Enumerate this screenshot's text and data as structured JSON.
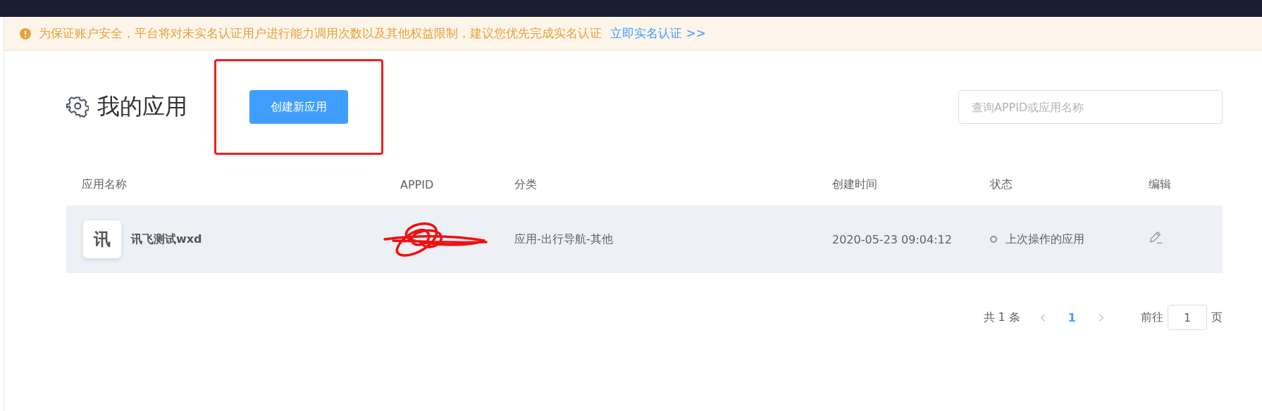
{
  "notice": {
    "text": "为保证账户安全，平台将对未实名认证用户进行能力调用次数以及其他权益限制，建议您优先完成实名认证",
    "link": "立即实名认证 >>"
  },
  "page": {
    "title": "我的应用",
    "create_button": "创建新应用",
    "search": {
      "placeholder": "查询APPID或应用名称"
    }
  },
  "table": {
    "columns": [
      "应用名称",
      "APPID",
      "分类",
      "创建时间",
      "状态",
      "编辑"
    ],
    "rows": [
      {
        "logo": "讯",
        "name": "讯飞测试wxd",
        "category": "应用-出行导航-其他",
        "created": "2020-05-23 09:04:12",
        "status": "上次操作的应用",
        "selected": true
      }
    ]
  },
  "pagination": {
    "total": "共 1 条",
    "pages": [
      {
        "label": "1",
        "selected": true
      }
    ],
    "goto_label": "前往",
    "goto_value": "1",
    "page_suffix": "页"
  }
}
